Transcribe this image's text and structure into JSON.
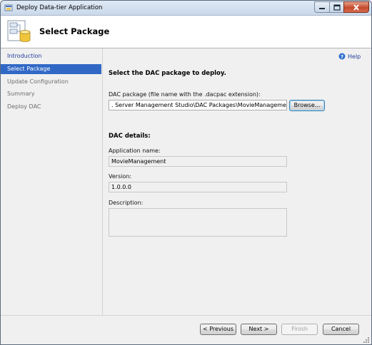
{
  "window": {
    "title": "Deploy Data-tier Application",
    "controls": {
      "minimize": "minimize-icon",
      "maximize": "maximize-icon",
      "close": "close-icon"
    }
  },
  "header": {
    "title": "Select Package",
    "icon": "database-package-icon"
  },
  "sidebar": {
    "items": [
      {
        "label": "Introduction",
        "state": "link"
      },
      {
        "label": "Select Package",
        "state": "selected"
      },
      {
        "label": "Update Configuration",
        "state": "disabled"
      },
      {
        "label": "Summary",
        "state": "disabled"
      },
      {
        "label": "Deploy DAC",
        "state": "disabled"
      }
    ]
  },
  "main": {
    "help_label": "Help",
    "instruction": "Select the DAC package to deploy.",
    "package_label": "DAC package (file name with the .dacpac extension):",
    "package_value": ". Server Management Studio\\DAC Packages\\MovieManagement.dacpac",
    "browse_label": "Browse...",
    "details_title": "DAC details:",
    "app_name_label": "Application name:",
    "app_name_value": "MovieManagement",
    "version_label": "Version:",
    "version_value": "1.0.0.0",
    "description_label": "Description:",
    "description_value": ""
  },
  "footer": {
    "previous_label": "< Previous",
    "next_label": "Next >",
    "finish_label": "Finish",
    "cancel_label": "Cancel"
  },
  "colors": {
    "selected_bg": "#3168c6",
    "link": "#1f3f9a",
    "close_button": "#c44b2c"
  }
}
